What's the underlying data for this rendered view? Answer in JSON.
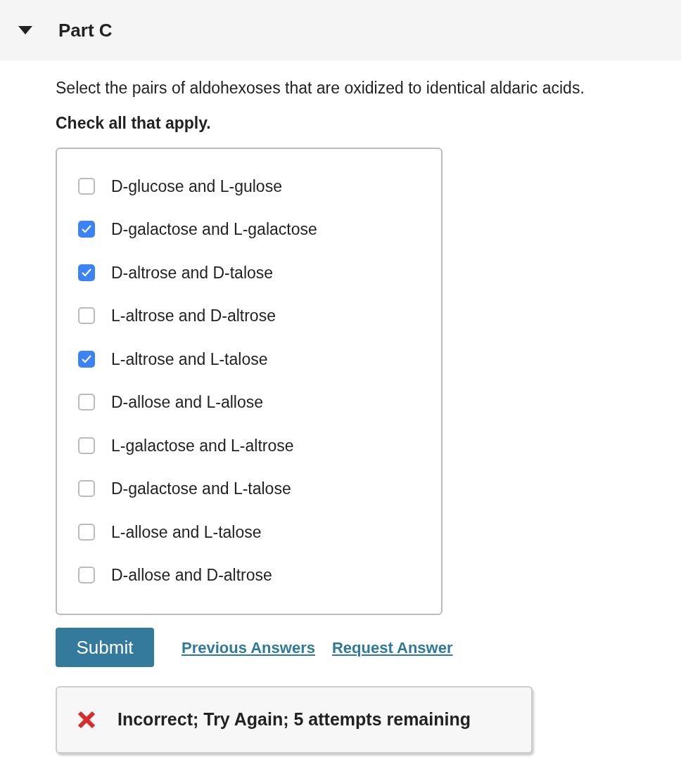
{
  "part": {
    "title": "Part C",
    "expanded": true
  },
  "question": {
    "prompt": "Select the pairs of aldohexoses that are oxidized to identical aldaric acids.",
    "instruction": "Check all that apply."
  },
  "options": [
    {
      "label": "D-glucose and L-gulose",
      "checked": false
    },
    {
      "label": "D-galactose and L-galactose",
      "checked": true
    },
    {
      "label": "D-altrose and D-talose",
      "checked": true
    },
    {
      "label": "L-altrose and D-altrose",
      "checked": false
    },
    {
      "label": "L-altrose and L-talose",
      "checked": true
    },
    {
      "label": "D-allose and L-allose",
      "checked": false
    },
    {
      "label": "L-galactose and L-altrose",
      "checked": false
    },
    {
      "label": "D-galactose and L-talose",
      "checked": false
    },
    {
      "label": "L-allose and L-talose",
      "checked": false
    },
    {
      "label": "D-allose and D-altrose",
      "checked": false
    }
  ],
  "actions": {
    "submit": "Submit",
    "links": [
      "Previous Answers",
      "Request Answer"
    ]
  },
  "feedback": {
    "kind": "incorrect",
    "message": "Incorrect; Try Again; 5 attempts remaining"
  }
}
